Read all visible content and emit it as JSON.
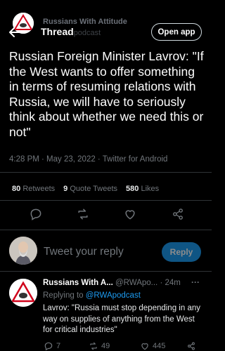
{
  "header": {
    "account_name": "Russians With Attitude",
    "title": "Thread",
    "title_overlap": "podcast",
    "open_app_label": "Open app"
  },
  "tweet": {
    "text": "Russian Foreign Minister Lavrov: \"If the West wants to offer something in terms of resuming relations with Russia, we will have to seriously think about whether we need this or not\"",
    "meta": "4:28 PM · May 23, 2022 · Twitter for Android",
    "retweets_count": "80",
    "retweets_label": "Retweets",
    "quotes_count": "9",
    "quotes_label": "Quote Tweets",
    "likes_count": "580",
    "likes_label": "Likes"
  },
  "composer": {
    "placeholder": "Tweet your reply",
    "button_label": "Reply"
  },
  "reply": {
    "name": "Russians With A...",
    "handle": "@RWApo...",
    "time": "· 24m",
    "more": "···",
    "replying_prefix": "Replying to",
    "replying_handle": "@RWApodcast",
    "text": "Lavrov: \"Russia must stop depending in any way on supplies of anything from the West for critical industries\"",
    "reply_count": "7",
    "retweet_count": "49",
    "like_count": "445"
  },
  "colors": {
    "accent": "#1d9bf0",
    "background": "#000000",
    "muted": "#71767b"
  }
}
